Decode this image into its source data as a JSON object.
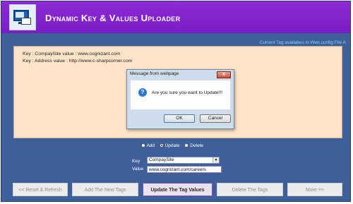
{
  "header": {
    "title": "Dynamic Key & Values Uploader"
  },
  "info_link": "Current Tag availabes in Web.config File A",
  "panel": {
    "lines": [
      "Key : CompaySite value : www.cognizant.com",
      "Key : Address value : http://www.c-sharpcorner.com"
    ]
  },
  "dialog": {
    "title": "Message from webpage",
    "close_label": "X",
    "icon": "question-icon",
    "message": "Are you sure you want to Update!!!",
    "ok_label": "OK",
    "cancel_label": "Cancel"
  },
  "mode": {
    "options": [
      "Add",
      "Update",
      "Delete"
    ],
    "selected": "Update"
  },
  "form": {
    "key_label": "Key",
    "key_value": "CompaySite",
    "value_label": "Value",
    "value_value": "www.cognizant.com/careers"
  },
  "buttons": {
    "reset": "<< Reset & Refresh",
    "add": "Add The New Tags",
    "update": "Update The Tag Values",
    "delete": "Delete The Tags",
    "more": "More >>"
  },
  "colors": {
    "header": "#8a25d3",
    "background": "#3e5f99",
    "panel": "#fde3c7",
    "link": "#7fd6ff"
  }
}
